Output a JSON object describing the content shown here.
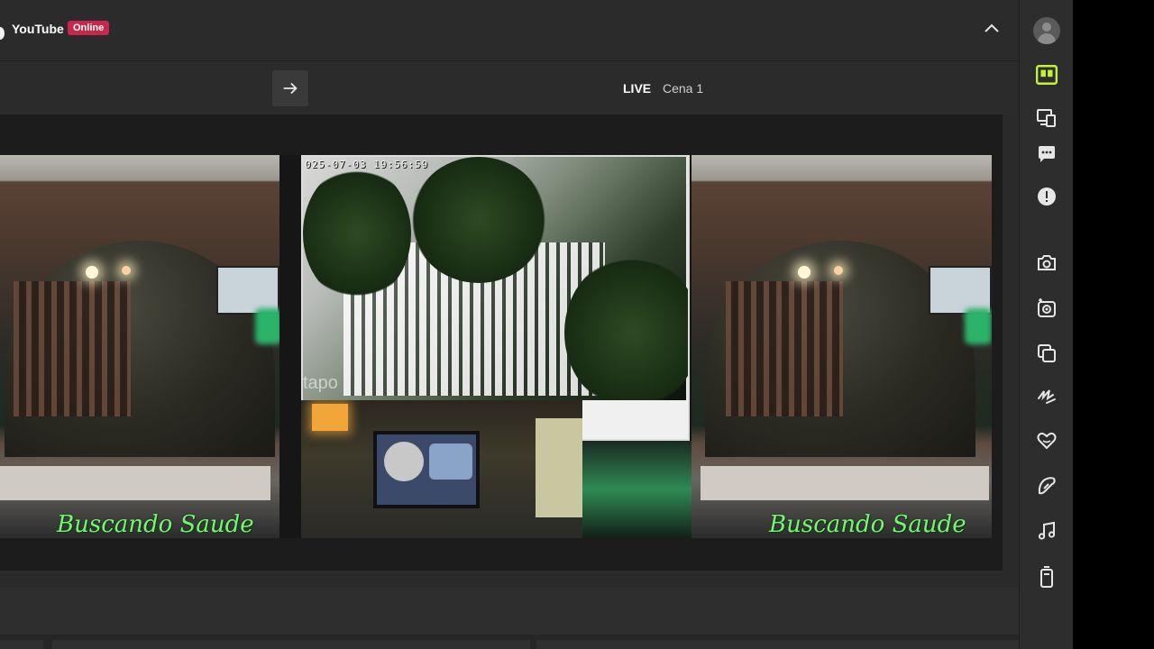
{
  "header": {
    "platform": "YouTube",
    "status_badge": "Online"
  },
  "toolbar": {
    "live_label": "LIVE",
    "scene_name": "Cena 1"
  },
  "preview": {
    "overlay_text_left": "Buscando Saude",
    "overlay_text_right": "Buscando Saude",
    "camera_timestamp": "025-07-03 19:56:59",
    "camera_watermark": "tapo"
  },
  "sidebar": {
    "items": [
      {
        "name": "profile-avatar"
      },
      {
        "name": "layout-icon",
        "active": true
      },
      {
        "name": "devices-icon"
      },
      {
        "name": "chat-icon"
      },
      {
        "name": "alert-icon"
      },
      {
        "name": "camera-icon"
      },
      {
        "name": "camera-add-icon"
      },
      {
        "name": "copy-icon"
      },
      {
        "name": "scribble-icon"
      },
      {
        "name": "heart-icon"
      },
      {
        "name": "brush-icon"
      },
      {
        "name": "music-icon"
      },
      {
        "name": "remote-icon"
      }
    ]
  },
  "colors": {
    "accent": "#c6f03a",
    "badge": "#c8264a",
    "overlay_text": "#7ef07a"
  }
}
